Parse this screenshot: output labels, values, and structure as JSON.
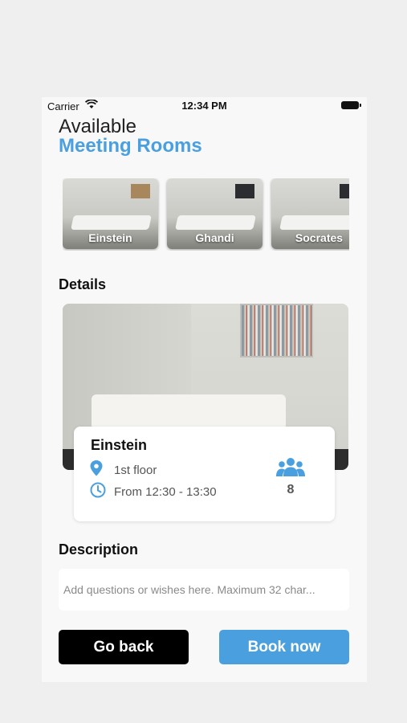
{
  "status_bar": {
    "carrier": "Carrier",
    "time": "12:34 PM"
  },
  "header": {
    "line1": "Available",
    "line2": "Meeting Rooms"
  },
  "rooms": [
    {
      "name": "Einstein"
    },
    {
      "name": "Ghandi"
    },
    {
      "name": "Socrates"
    }
  ],
  "details": {
    "heading": "Details",
    "room_name": "Einstein",
    "floor": "1st floor",
    "time": "From 12:30 - 13:30",
    "capacity": "8"
  },
  "description": {
    "heading": "Description",
    "placeholder": "Add questions or wishes here. Maximum 32 char..."
  },
  "actions": {
    "back_label": "Go back",
    "book_label": "Book now"
  },
  "colors": {
    "accent": "#4a9fdf",
    "primary_button": "#000000"
  }
}
